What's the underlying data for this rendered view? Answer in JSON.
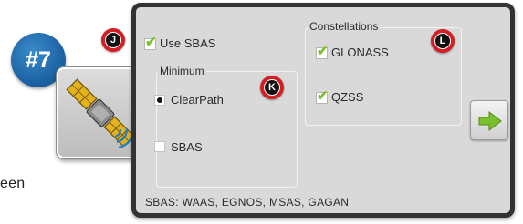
{
  "step_badge": "#7",
  "doc_fragment": "een",
  "icons": {
    "satellite": "satellite-icon",
    "next": "arrow-right-icon"
  },
  "colors": {
    "accent_green": "#7cbf2d",
    "callout_red": "#d21f26",
    "badge_blue": "#1d64a6",
    "panel_bg": "#d9d9d9",
    "panel_border": "#333333"
  },
  "use_sbas": {
    "label": "Use SBAS",
    "checked": true
  },
  "minimum": {
    "title": "Minimum",
    "options": [
      {
        "label": "ClearPath",
        "selected": true
      },
      {
        "label": "SBAS",
        "selected": false
      }
    ]
  },
  "constellations": {
    "title": "Constellations",
    "items": [
      {
        "label": "GLONASS",
        "checked": true
      },
      {
        "label": "QZSS",
        "checked": true
      }
    ]
  },
  "footer": "SBAS: WAAS, EGNOS, MSAS, GAGAN",
  "callouts": [
    "J",
    "K",
    "L"
  ]
}
